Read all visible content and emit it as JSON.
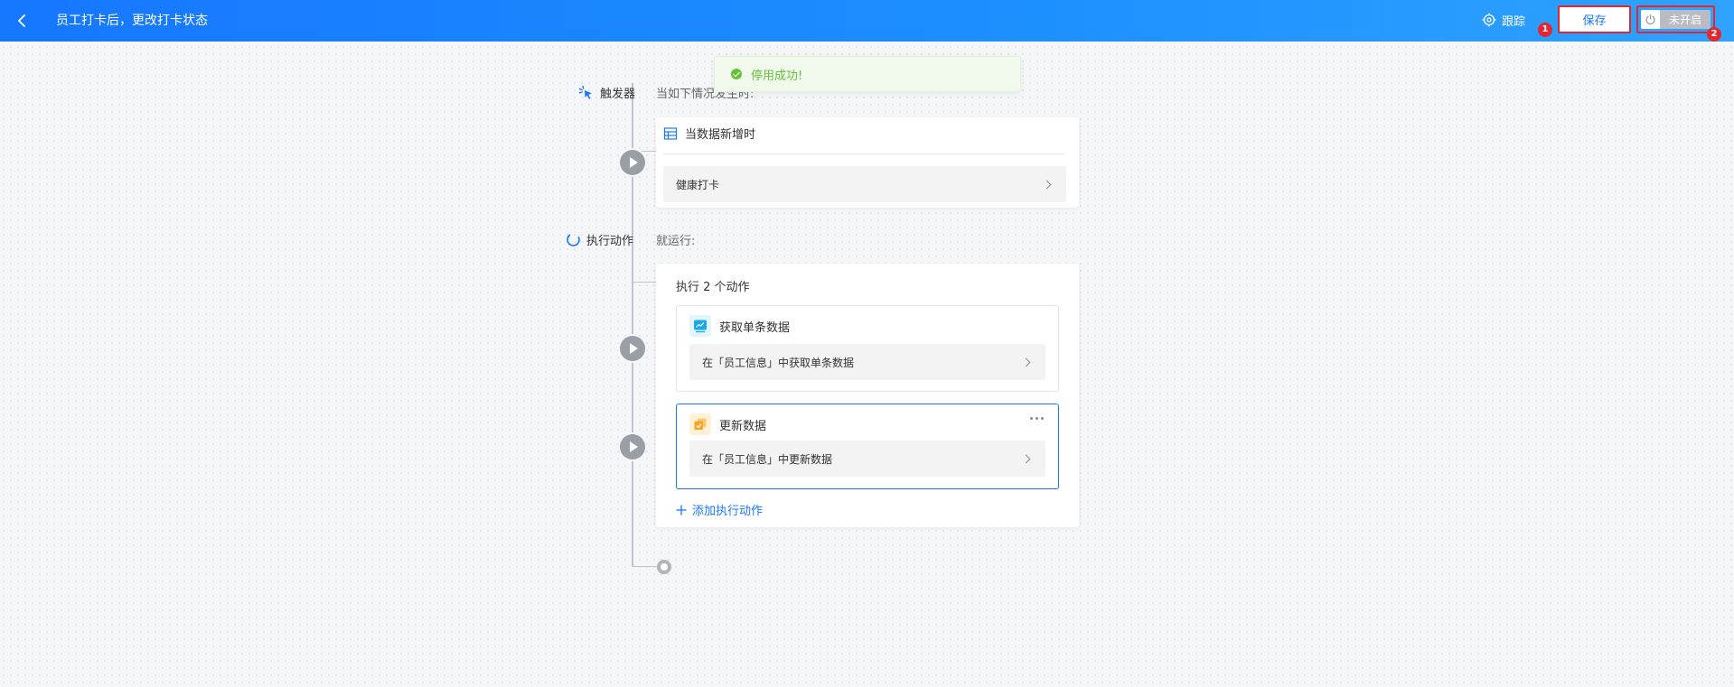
{
  "header": {
    "title": "员工打卡后，更改打卡状态",
    "track_label": "跟踪",
    "save_label": "保存",
    "toggle_label": "未开启",
    "badges": [
      "1",
      "2"
    ]
  },
  "toast": {
    "message": "停用成功!",
    "color": "#67c23a"
  },
  "trigger": {
    "label": "触发器",
    "sub_text": "当如下情况发生时:",
    "event": "当数据新增时",
    "source": "健康打卡"
  },
  "actions_section": {
    "label": "执行动作",
    "sub_text": "就运行:",
    "count_text": "执行 2 个动作",
    "items": [
      {
        "title": "获取单条数据",
        "detail": "在「员工信息」中获取单条数据",
        "icon": "chart-icon",
        "icon_color": "#1aa8e6"
      },
      {
        "title": "更新数据",
        "detail": "在「员工信息」中更新数据",
        "icon": "update-icon",
        "icon_color": "#f5a623"
      }
    ],
    "add_label": "添加执行动作"
  },
  "colors": {
    "accent": "#1677ff",
    "highlight": "#e5262e"
  }
}
